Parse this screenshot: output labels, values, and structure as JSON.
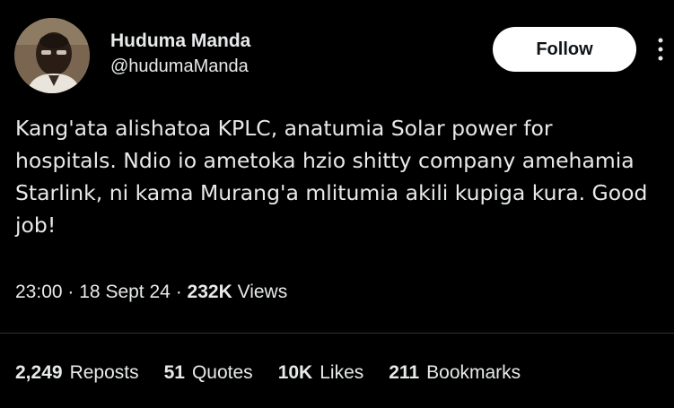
{
  "user": {
    "display_name": "Huduma Manda",
    "handle": "@hudumaManda"
  },
  "follow_label": "Follow",
  "more_icon": "more-vertical-icon",
  "tweet": {
    "text": "Kang'ata alishatoa KPLC, anatumia Solar power for hospitals. Ndio io ametoka hzio shitty company amehamia Starlink, ni kama Murang'a mlitumia akili kupiga kura. Good job!"
  },
  "meta": {
    "time": "23:00",
    "sep1": "·",
    "date": "18 Sept 24",
    "sep2": "·",
    "views_count": "232K",
    "views_label": "Views"
  },
  "stats": {
    "reposts": {
      "count": "2,249",
      "label": "Reposts"
    },
    "quotes": {
      "count": "51",
      "label": "Quotes"
    },
    "likes": {
      "count": "10K",
      "label": "Likes"
    },
    "bookmarks": {
      "count": "211",
      "label": "Bookmarks"
    }
  },
  "colors": {
    "background": "#000000",
    "text": "#e7e9ea",
    "divider": "#2f3336",
    "follow_bg": "#ffffff",
    "follow_text": "#0f1419"
  }
}
